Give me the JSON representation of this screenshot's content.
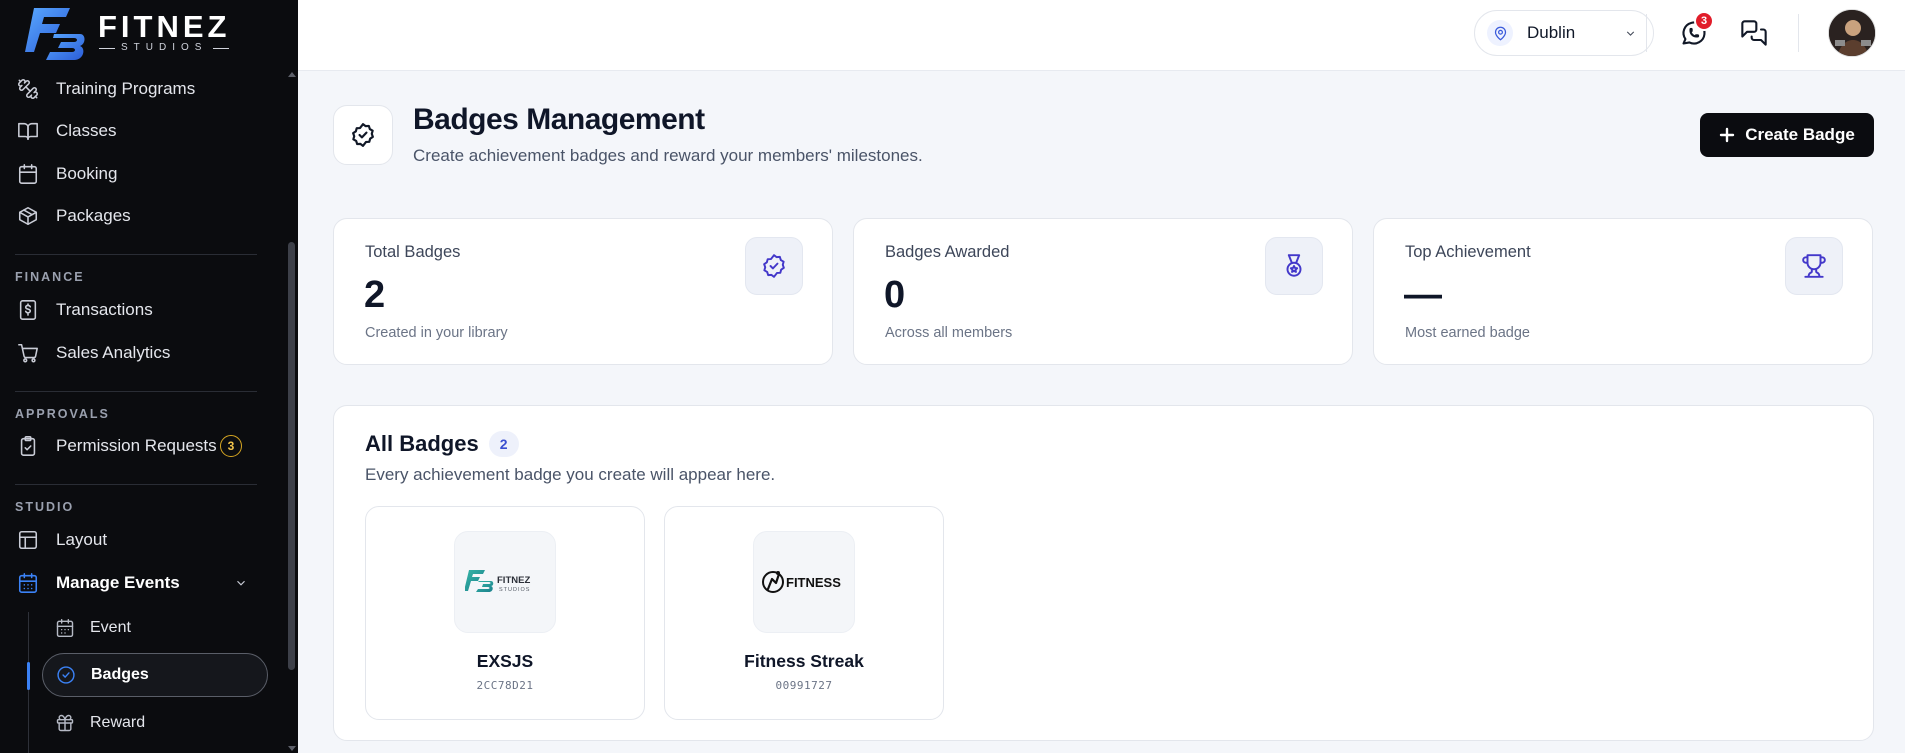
{
  "brand": {
    "name": "FITNEZ",
    "tagline": "STUDIOS"
  },
  "sidebar": {
    "items_top": [
      {
        "label": "Training Programs",
        "icon": "dumbbell-icon"
      },
      {
        "label": "Classes",
        "icon": "book-open-icon"
      },
      {
        "label": "Booking",
        "icon": "calendar-icon"
      },
      {
        "label": "Packages",
        "icon": "package-icon"
      }
    ],
    "finance": {
      "label": "FINANCE",
      "items": [
        {
          "label": "Transactions",
          "icon": "dollar-receipt-icon"
        },
        {
          "label": "Sales Analytics",
          "icon": "shopping-cart-icon"
        }
      ]
    },
    "approvals": {
      "label": "APPROVALS",
      "items": [
        {
          "label": "Permission Requests",
          "icon": "clipboard-check-icon",
          "count": "3"
        }
      ]
    },
    "studio": {
      "label": "STUDIO",
      "items": [
        {
          "label": "Layout",
          "icon": "layout-icon"
        },
        {
          "label": "Manage Events",
          "icon": "calendar-icon",
          "active": true
        }
      ],
      "sub_items": [
        {
          "label": "Event",
          "icon": "calendar-icon"
        },
        {
          "label": "Badges",
          "icon": "badge-check-icon",
          "active": true
        },
        {
          "label": "Reward",
          "icon": "gift-icon"
        }
      ]
    }
  },
  "topbar": {
    "location": "Dublin",
    "whatsapp_notifications": "3"
  },
  "header": {
    "title": "Badges Management",
    "subtitle": "Create achievement badges and reward your members' milestones.",
    "create_label": "Create Badge"
  },
  "stats": [
    {
      "label": "Total Badges",
      "value": "2",
      "foot": "Created in your library",
      "icon": "badge-check-icon"
    },
    {
      "label": "Badges Awarded",
      "value": "0",
      "foot": "Across all members",
      "icon": "medal-icon"
    },
    {
      "label": "Top Achievement",
      "value": "—",
      "foot": "Most earned badge",
      "icon": "trophy-icon"
    }
  ],
  "badges_panel": {
    "title": "All Badges",
    "count": "2",
    "subtitle": "Every achievement badge you create will appear here.",
    "badges": [
      {
        "name": "EXSJS",
        "code": "2CC78D21",
        "logo_text": "FITNEZ",
        "logo_sub": "STUDIOS"
      },
      {
        "name": "Fitness Streak",
        "code": "00991727",
        "logo_text": "FITNESS"
      }
    ]
  },
  "colors": {
    "sidebar_bg": "#0b0c0f",
    "accent": "#3b82f6",
    "primary_button": "#0b0c10",
    "notification": "#e11d2a",
    "stat_icon": "#4338ca",
    "pending_badge": "#d6a622"
  }
}
